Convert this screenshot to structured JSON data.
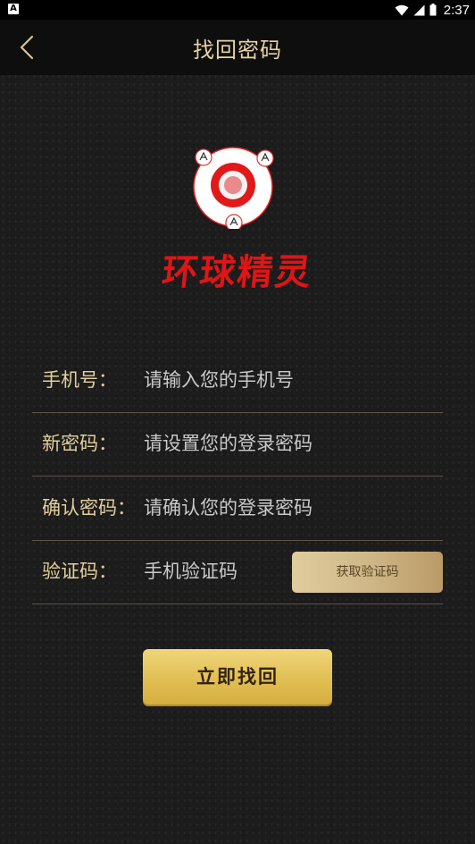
{
  "status_bar": {
    "left_icon_label": "A",
    "time": "2:37",
    "icons": [
      "wifi-icon",
      "signal-icon",
      "battery-icon"
    ]
  },
  "header": {
    "title": "找回密码",
    "back_icon": "chevron-left-icon"
  },
  "brand": {
    "name": "环球精灵",
    "color": "#e01515"
  },
  "form": {
    "phone": {
      "label": "手机号：",
      "placeholder": "请输入您的手机号"
    },
    "new_password": {
      "label": "新密码：",
      "placeholder": "请设置您的登录密码"
    },
    "confirm_password": {
      "label": "确认密码：",
      "placeholder": "请确认您的登录密码"
    },
    "verify_code": {
      "label": "验证码：",
      "placeholder": "手机验证码",
      "button_label": "获取验证码"
    }
  },
  "submit": {
    "label": "立即找回"
  },
  "colors": {
    "accent_gold": "#e2cf9c",
    "button_gold": "#e0bd50",
    "background": "#1c1c1c"
  }
}
